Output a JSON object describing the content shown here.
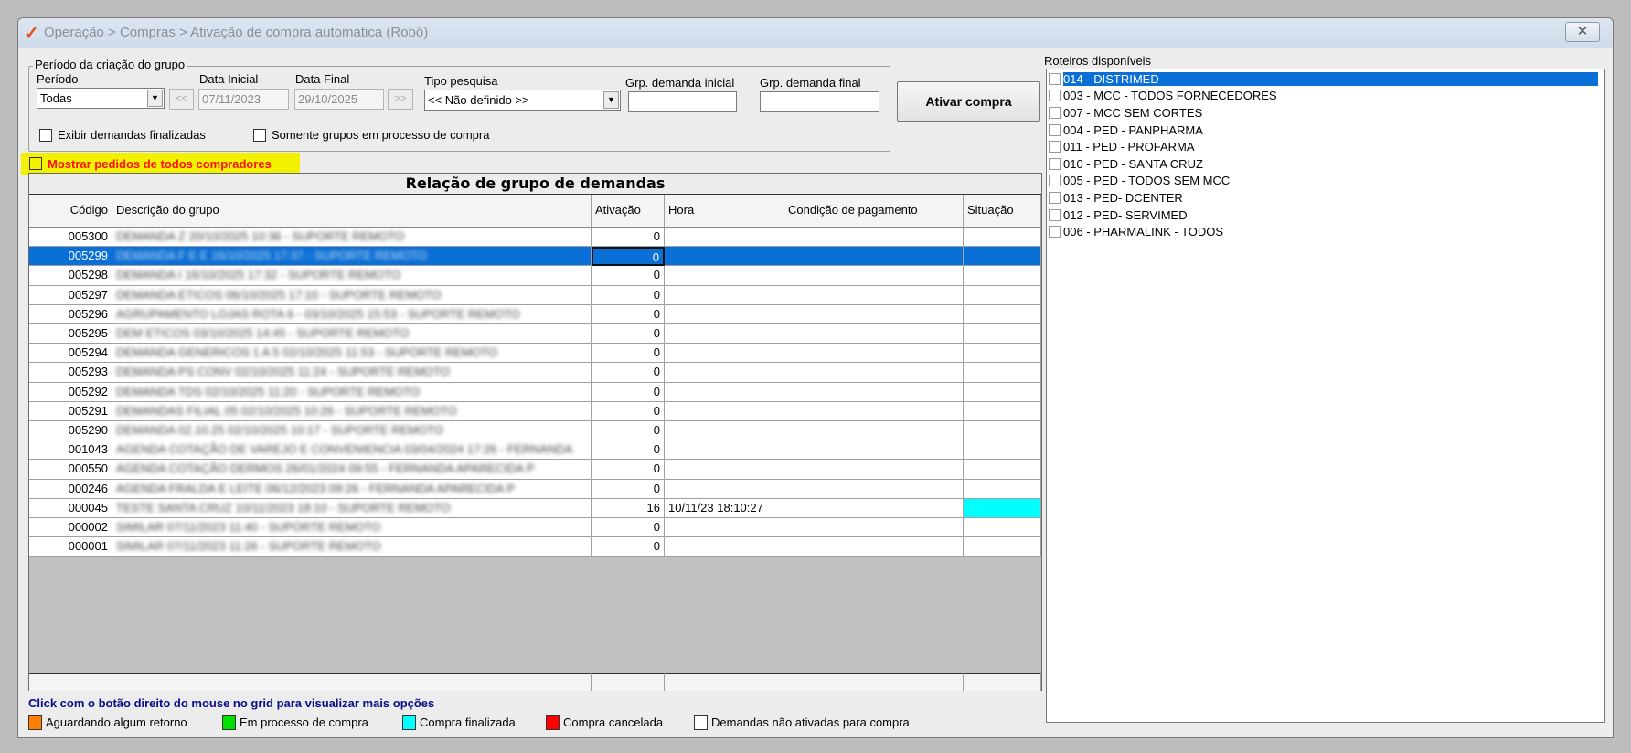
{
  "window": {
    "title": "Operação > Compras > Ativação de compra automática (Robô)",
    "close_label": "✕"
  },
  "filters": {
    "group_title": "Período da criação do grupo",
    "periodo_label": "Período",
    "periodo_value": "Todas",
    "prev_label": "<<",
    "next_label": ">>",
    "data_inicial_label": "Data Inicial",
    "data_inicial_value": "07/11/2023",
    "data_final_label": "Data Final",
    "data_final_value": "29/10/2025",
    "tipo_label": "Tipo pesquisa",
    "tipo_value": "<< Não definido >>",
    "grp_inicial_label": "Grp. demanda inicial",
    "grp_inicial_value": "",
    "grp_final_label": "Grp. demanda final",
    "grp_final_value": "",
    "exibir_label": "Exibir demandas finalizadas",
    "somente_label": "Somente grupos em processo de compra",
    "mostrar_label": "Mostrar pedidos de todos compradores"
  },
  "ativar_label": "Ativar compra",
  "grid": {
    "title": "Relação de grupo de demandas",
    "columns": [
      "Código",
      "Descrição do grupo",
      "Ativação",
      "Hora",
      "Condição de pagamento",
      "Situação"
    ],
    "rows": [
      {
        "codigo": "005300",
        "descricao": "DEMANDA Z 20/10/2025 10:36 - SUPORTE REMOTO",
        "ativacao": "0",
        "hora": ""
      },
      {
        "codigo": "005299",
        "descricao": "DEMANDA F E E 16/10/2025 17:37 - SUPORTE REMOTO",
        "ativacao": "0",
        "hora": ""
      },
      {
        "codigo": "005298",
        "descricao": "DEMANDA I 16/10/2025 17:32 - SUPORTE REMOTO",
        "ativacao": "0",
        "hora": ""
      },
      {
        "codigo": "005297",
        "descricao": "DEMANDA ETICOS 06/10/2025 17:10 - SUPORTE REMOTO",
        "ativacao": "0",
        "hora": ""
      },
      {
        "codigo": "005296",
        "descricao": "AGRUPAMENTO LOJAS ROTA 6 - 03/10/2025 15:53 - SUPORTE REMOTO",
        "ativacao": "0",
        "hora": ""
      },
      {
        "codigo": "005295",
        "descricao": "DEM ETICOS 03/10/2025 14:45 - SUPORTE REMOTO",
        "ativacao": "0",
        "hora": ""
      },
      {
        "codigo": "005294",
        "descricao": "DEMANDA GENERICOS 1 A 5 02/10/2025 11:53 - SUPORTE REMOTO",
        "ativacao": "0",
        "hora": ""
      },
      {
        "codigo": "005293",
        "descricao": "DEMANDA PS CONV 02/10/2025 11:24 - SUPORTE REMOTO",
        "ativacao": "0",
        "hora": ""
      },
      {
        "codigo": "005292",
        "descricao": "DEMANDA TDS 02/10/2025 11:20 - SUPORTE REMOTO",
        "ativacao": "0",
        "hora": ""
      },
      {
        "codigo": "005291",
        "descricao": "DEMANDAS FILIAL 05 02/10/2025 10:26 - SUPORTE REMOTO",
        "ativacao": "0",
        "hora": ""
      },
      {
        "codigo": "005290",
        "descricao": "DEMANDA 02.10.25 02/10/2025 10:17 - SUPORTE REMOTO",
        "ativacao": "0",
        "hora": ""
      },
      {
        "codigo": "001043",
        "descricao": "AGENDA COTAÇÃO DE VAREJO E CONVENIENCIA 03/04/2024 17:26 - FERNANDA",
        "ativacao": "0",
        "hora": ""
      },
      {
        "codigo": "000550",
        "descricao": "AGENDA COTAÇÃO DERMOS 26/01/2024 09:55 - FERNANDA APARECIDA P",
        "ativacao": "0",
        "hora": ""
      },
      {
        "codigo": "000246",
        "descricao": "AGENDA FRALDA E LEITE 06/12/2023 09:26 - FERNANDA APARECIDA P",
        "ativacao": "0",
        "hora": ""
      },
      {
        "codigo": "000045",
        "descricao": "TESTE SANTA CRUZ 10/11/2023 18:10 - SUPORTE REMOTO",
        "ativacao": "16",
        "hora": "10/11/23 18:10:27",
        "situacao_color": "#00ffff"
      },
      {
        "codigo": "000002",
        "descricao": "SIMILAR 07/11/2023 11:40 - SUPORTE REMOTO",
        "ativacao": "0",
        "hora": ""
      },
      {
        "codigo": "000001",
        "descricao": "SIMILAR 07/11/2023 11:26 - SUPORTE REMOTO",
        "ativacao": "0",
        "hora": ""
      }
    ],
    "selected_index": 1
  },
  "hint": "Click com o botão direito do mouse no grid para visualizar mais opções",
  "legend": [
    {
      "label": "Aguardando algum retorno",
      "color": "#ff8000"
    },
    {
      "label": "Em processo de compra",
      "color": "#00e000"
    },
    {
      "label": "Compra finalizada",
      "color": "#00ffff"
    },
    {
      "label": "Compra cancelada",
      "color": "#ff0000"
    },
    {
      "label": "Demandas não ativadas para compra",
      "color": "#ffffff"
    }
  ],
  "roteiros": {
    "label": "Roteiros disponíveis",
    "items": [
      "014 - DISTRIMED",
      "003 - MCC - TODOS FORNECEDORES",
      "007 - MCC SEM CORTES",
      "004 - PED - PANPHARMA",
      "011 - PED - PROFARMA",
      "010 - PED - SANTA CRUZ",
      "005 - PED - TODOS SEM MCC",
      "013 - PED- DCENTER",
      "012 - PED- SERVIMED",
      "006 - PHARMALINK - TODOS"
    ],
    "selected_index": 0
  }
}
